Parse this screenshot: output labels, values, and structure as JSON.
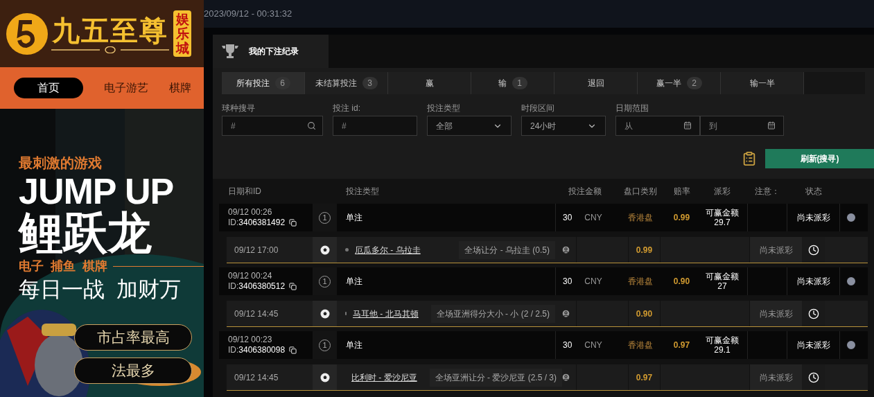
{
  "top_bar": {
    "timestamp": "2023/09/12 - 00:31:32"
  },
  "site": {
    "brand": "九五至尊",
    "badge": "娱乐城",
    "nav": [
      {
        "label": "首页",
        "selected": true
      },
      {
        "label": "电子游艺",
        "selected": false
      },
      {
        "label": "棋牌",
        "selected": false
      }
    ]
  },
  "banner": {
    "tagline": "最刺激的游戏",
    "headline_en": "JUMP UP",
    "headline_cn": "鲤跃龙",
    "categories": "电子  捕鱼  棋牌",
    "slogan": "每日一战  加财万",
    "buttons": [
      "市占率最高",
      "法最多"
    ]
  },
  "modal": {
    "title": "我的下注纪录",
    "tabs": [
      {
        "label": "所有投注",
        "count": "6",
        "selected": true
      },
      {
        "label": "未结算投注",
        "count": "3",
        "selected": false
      },
      {
        "label": "赢",
        "selected": false
      },
      {
        "label": "输",
        "count": "1",
        "selected": false
      },
      {
        "label": "退回",
        "selected": false
      },
      {
        "label": "赢一半",
        "count": "2",
        "selected": false
      },
      {
        "label": "输一半",
        "selected": false
      }
    ],
    "filters": [
      {
        "kind": "search",
        "label": "球种搜寻",
        "placeholder": "#"
      },
      {
        "kind": "text",
        "label": "投注 id:",
        "placeholder": "#"
      },
      {
        "kind": "select",
        "label": "投注类型",
        "value": "全部"
      },
      {
        "kind": "select",
        "label": "时段区间",
        "value": "24小时"
      },
      {
        "kind": "daterange",
        "label": "日期范围",
        "from_placeholder": "从",
        "to_placeholder": "到"
      }
    ],
    "refresh_button": "刷新(搜寻)",
    "columns": [
      "日期和ID",
      "投注类型",
      "投注金额",
      "盘口类别",
      "赔率",
      "派彩",
      "注意：",
      "状态"
    ],
    "bets": [
      {
        "date": "09/12 00:26",
        "id_label": "ID:",
        "id": "3406381492",
        "bet_count": "1",
        "type": "单注",
        "amount": "30",
        "currency": "CNY",
        "market": "香港盘",
        "odds": "0.99",
        "payout_label": "可赢金额",
        "payout": "29.7",
        "status": "尚未派彩",
        "selection": {
          "time": "09/12 17:00",
          "match": "厄瓜多尔 - 乌拉圭",
          "pick": "全场让分 - 乌拉圭 (0.5)",
          "odds": "0.99",
          "status": "尚未派彩"
        }
      },
      {
        "date": "09/12 00:24",
        "id_label": "ID:",
        "id": "3406380512",
        "bet_count": "1",
        "type": "单注",
        "amount": "30",
        "currency": "CNY",
        "market": "香港盘",
        "odds": "0.90",
        "payout_label": "可赢金额",
        "payout": "27",
        "status": "尚未派彩",
        "selection": {
          "time": "09/12 14:45",
          "match": "马耳他 - 北马其顿",
          "pick": "全场亚洲得分大小 - 小 (2 / 2.5)",
          "odds": "0.90",
          "status": "尚未派彩"
        }
      },
      {
        "date": "09/12 00:23",
        "id_label": "ID:",
        "id": "3406380098",
        "bet_count": "1",
        "type": "单注",
        "amount": "30",
        "currency": "CNY",
        "market": "香港盘",
        "odds": "0.97",
        "payout_label": "可赢金额",
        "payout": "29.1",
        "status": "尚未派彩",
        "selection": {
          "time": "09/12 14:45",
          "match": "比利时 - 爱沙尼亚",
          "pick": "全场亚洲让分 - 爱沙尼亚 (2.5 / 3)",
          "odds": "0.97",
          "status": "尚未派彩"
        }
      }
    ]
  }
}
